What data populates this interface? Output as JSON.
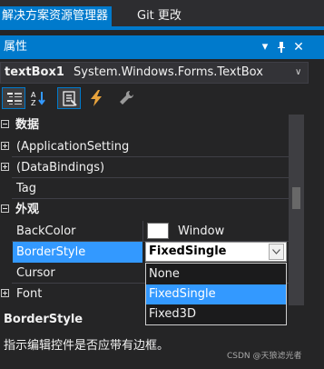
{
  "tabs": {
    "active": "解决方案资源管理器",
    "git": "Git 更改"
  },
  "panel": {
    "title": "属性",
    "pin_glyph": "❘",
    "menu_glyph": "▾",
    "close_glyph": "✕"
  },
  "object_selector": {
    "name": "textBox1",
    "type": "System.Windows.Forms.TextBox",
    "chevron": "∨"
  },
  "toolbar": {
    "icons": [
      "categorized-icon",
      "alphabetical-icon",
      "properties-icon",
      "events-icon",
      "property-pages-icon"
    ]
  },
  "grid": {
    "categories": {
      "data": "数据",
      "appearance": "外观"
    },
    "rows": {
      "application_settings": "(ApplicationSetting",
      "data_bindings": "(DataBindings)",
      "tag": "Tag",
      "back_color": "BackColor",
      "back_color_value": "Window",
      "border_style": "BorderStyle",
      "cursor": "Cursor",
      "font": "Font"
    }
  },
  "combo": {
    "value": "FixedSingle",
    "options": [
      "None",
      "FixedSingle",
      "Fixed3D"
    ],
    "selected_index": 1
  },
  "description": {
    "title": "BorderStyle",
    "text": "指示编辑控件是否应带有边框。"
  },
  "watermark": "CSDN @天狼滤光者",
  "colors": {
    "accent": "#007acc",
    "selection": "#3399ff",
    "background": "#252526"
  }
}
